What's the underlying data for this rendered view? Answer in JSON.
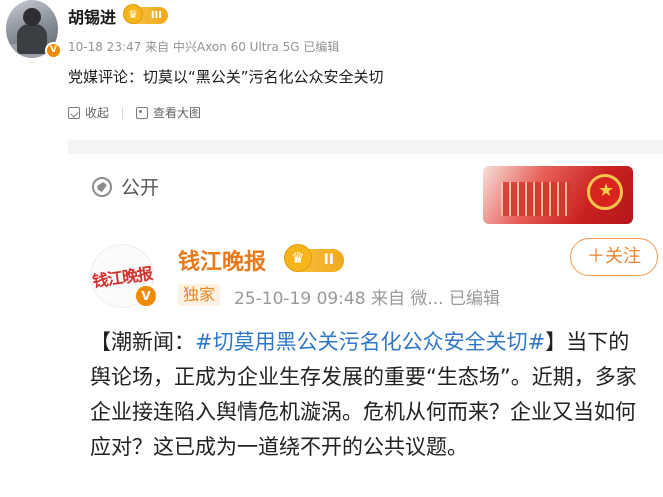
{
  "post": {
    "username": "胡锡进",
    "rank_level": "III",
    "meta": "10-18 23:47  来自 中兴Axon 60 Ultra 5G 已编辑",
    "text": "党媒评论：切莫以“黑公关”污名化公众安全关切",
    "actions": {
      "collect_label": "收起",
      "view_large_label": "查看大图"
    }
  },
  "embedded": {
    "public_label": "公开",
    "source": {
      "logo_text": "钱江晚报",
      "name": "钱江晚报",
      "rank_level": "II",
      "exclusive_label": "独家",
      "meta": "25-10-19 09:48  来自 微...  已编辑",
      "follow_label": "＋关注"
    },
    "article": {
      "prefix": "【潮新闻：",
      "hashtag": "#切莫用黑公关污名化公众安全关切#",
      "body": "】当下的舆论场，正成为企业生存发展的重要“生态场”。近期，多家企业接连陷入舆情危机漩涡。危机从何而来？企业又当如何应对？这已成为一道绕不开的公共议题。"
    }
  },
  "colors": {
    "accent_orange": "#e87a1b",
    "hashtag_blue": "#2f77c8",
    "meta_gray": "#939393"
  }
}
